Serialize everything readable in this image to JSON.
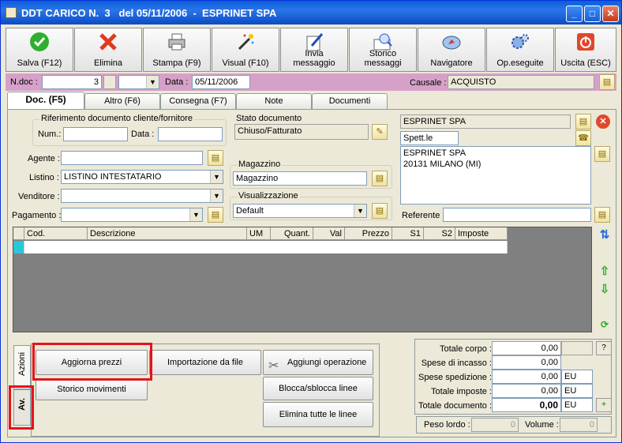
{
  "window": {
    "title": "DDT CARICO N.  3   del 05/11/2006  -  ESPRINET SPA",
    "controls": {
      "minimize": "_",
      "maximize": "□",
      "close": "✕"
    }
  },
  "toolbar": [
    {
      "label": "Salva (F12)",
      "icon": "check-icon"
    },
    {
      "label": "Elimina",
      "icon": "delete-x-icon"
    },
    {
      "label": "Stampa (F9)",
      "icon": "printer-icon"
    },
    {
      "label": "Visual (F10)",
      "icon": "magic-wand-icon"
    },
    {
      "label": "Invia\nmessaggio",
      "icon": "pen-paper-icon"
    },
    {
      "label": "Storico\nmessaggi",
      "icon": "search-mail-icon"
    },
    {
      "label": "Navigatore",
      "icon": "compass-icon"
    },
    {
      "label": "Op.eseguite",
      "icon": "gears-icon"
    },
    {
      "label": "Uscita (ESC)",
      "icon": "power-icon"
    }
  ],
  "docbar": {
    "ndoc_label": "N.doc :",
    "ndoc_value": "3",
    "data_label": "Data :",
    "data_value": "05/11/2006",
    "causale_label": "Causale :",
    "causale_value": "ACQUISTO"
  },
  "tabs": [
    "Doc. (F5)",
    "Altro (F6)",
    "Consegna (F7)",
    "Note",
    "Documenti"
  ],
  "riferimento": {
    "group_label": "Riferimento documento cliente/fornitore",
    "num_label": "Num.:",
    "data_label": "Data :"
  },
  "form": {
    "agente_label": "Agente :",
    "listino_label": "Listino :",
    "listino_value": "LISTINO INTESTATARIO",
    "venditore_label": "Venditore :",
    "pagamento_label": "Pagamento :"
  },
  "stato": {
    "label": "Stato documento",
    "value": "Chiuso/Fatturato"
  },
  "magazzino": {
    "label": "Magazzino",
    "value": "Magazzino"
  },
  "visualizzazione": {
    "label": "Visualizzazione",
    "value": "Default"
  },
  "cliente": {
    "name": "ESPRINET SPA",
    "salutation": "Spett.le",
    "address_line1": "ESPRINET SPA",
    "address_line2": "20131 MILANO (MI)",
    "referente_label": "Referente"
  },
  "grid": {
    "columns": [
      "Cod.",
      "Descrizione",
      "UM",
      "Quant.",
      "Val",
      "Prezzo",
      "S1",
      "S2",
      "Imposte"
    ]
  },
  "actions": {
    "tab_azioni": "Azioni",
    "tab_av": "Av.",
    "aggiorna_prezzi": "Aggiorna prezzi",
    "importazione": "Importazione da file",
    "aggiungi_operazione": "Aggiungi operazione",
    "storico_movimenti": "Storico movimenti",
    "blocca": "Blocca/sblocca linee",
    "elimina_linee": "Elimina tutte le linee"
  },
  "totals": {
    "corpo_label": "Totale corpo :",
    "corpo_value": "0,00",
    "incasso_label": "Spese di incasso :",
    "incasso_value": "0,00",
    "spedizione_label": "Spese spedizione :",
    "spedizione_value": "0,00",
    "spedizione_cur": "EU",
    "imposte_label": "Totale imposte :",
    "imposte_value": "0,00",
    "imposte_cur": "EU",
    "documento_label": "Totale documento :",
    "documento_value": "0,00",
    "documento_cur": "EU",
    "help": "?",
    "peso_label": "Peso lordo :",
    "peso_value": "0",
    "volume_label": "Volume :",
    "volume_value": "0"
  }
}
